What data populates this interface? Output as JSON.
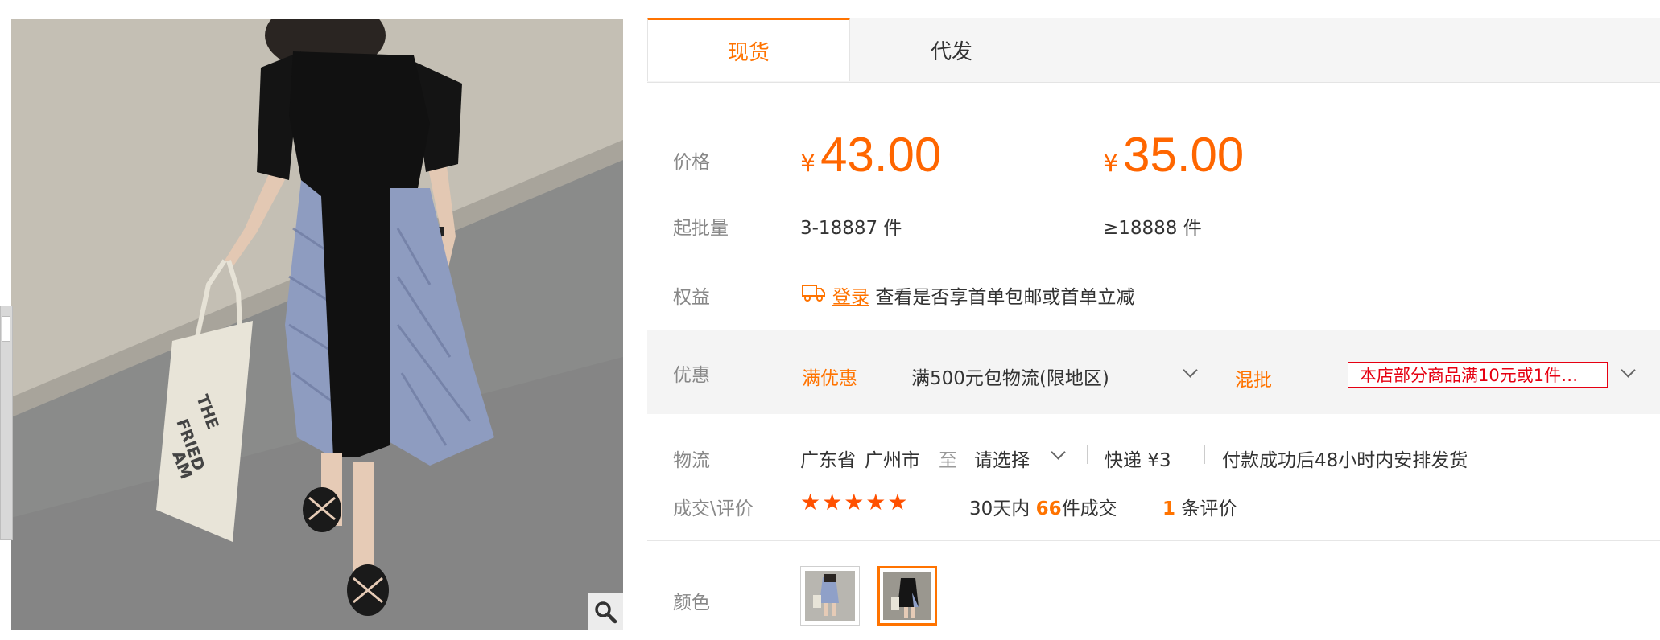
{
  "tabs": {
    "active": "现货",
    "other": "代发"
  },
  "labels": {
    "price": "价格",
    "moq": "起批量",
    "rights": "权益",
    "promo": "优惠",
    "logistics": "物流",
    "deals": "成交\\评价",
    "color": "颜色"
  },
  "prices": [
    {
      "symbol": "¥",
      "amount": "43.00",
      "range": "3-18887",
      "unit": "件"
    },
    {
      "symbol": "¥",
      "amount": "35.00",
      "range": "≥18888",
      "unit": "件"
    }
  ],
  "rights": {
    "login_link": "登录",
    "text": "查看是否享首单包邮或首单立减"
  },
  "promo": {
    "tag1": "满优惠",
    "desc1": "满500元包物流(限地区)",
    "tag2": "混批",
    "coupon": "本店部分商品满10元或1件…"
  },
  "logistics": {
    "province": "广东省",
    "city": "广州市",
    "to": "至",
    "select": "请选择",
    "express": "快递 ¥3",
    "ship_note": "付款成功后48小时内安排发货"
  },
  "deals": {
    "stars": "★★★★★",
    "prefix": "30天内",
    "count": "66",
    "suffix": "件成交",
    "review_count": "1",
    "review_suffix": "条评价"
  },
  "colors": {
    "accent": "#ff7300",
    "coupon_red": "#e60012"
  }
}
